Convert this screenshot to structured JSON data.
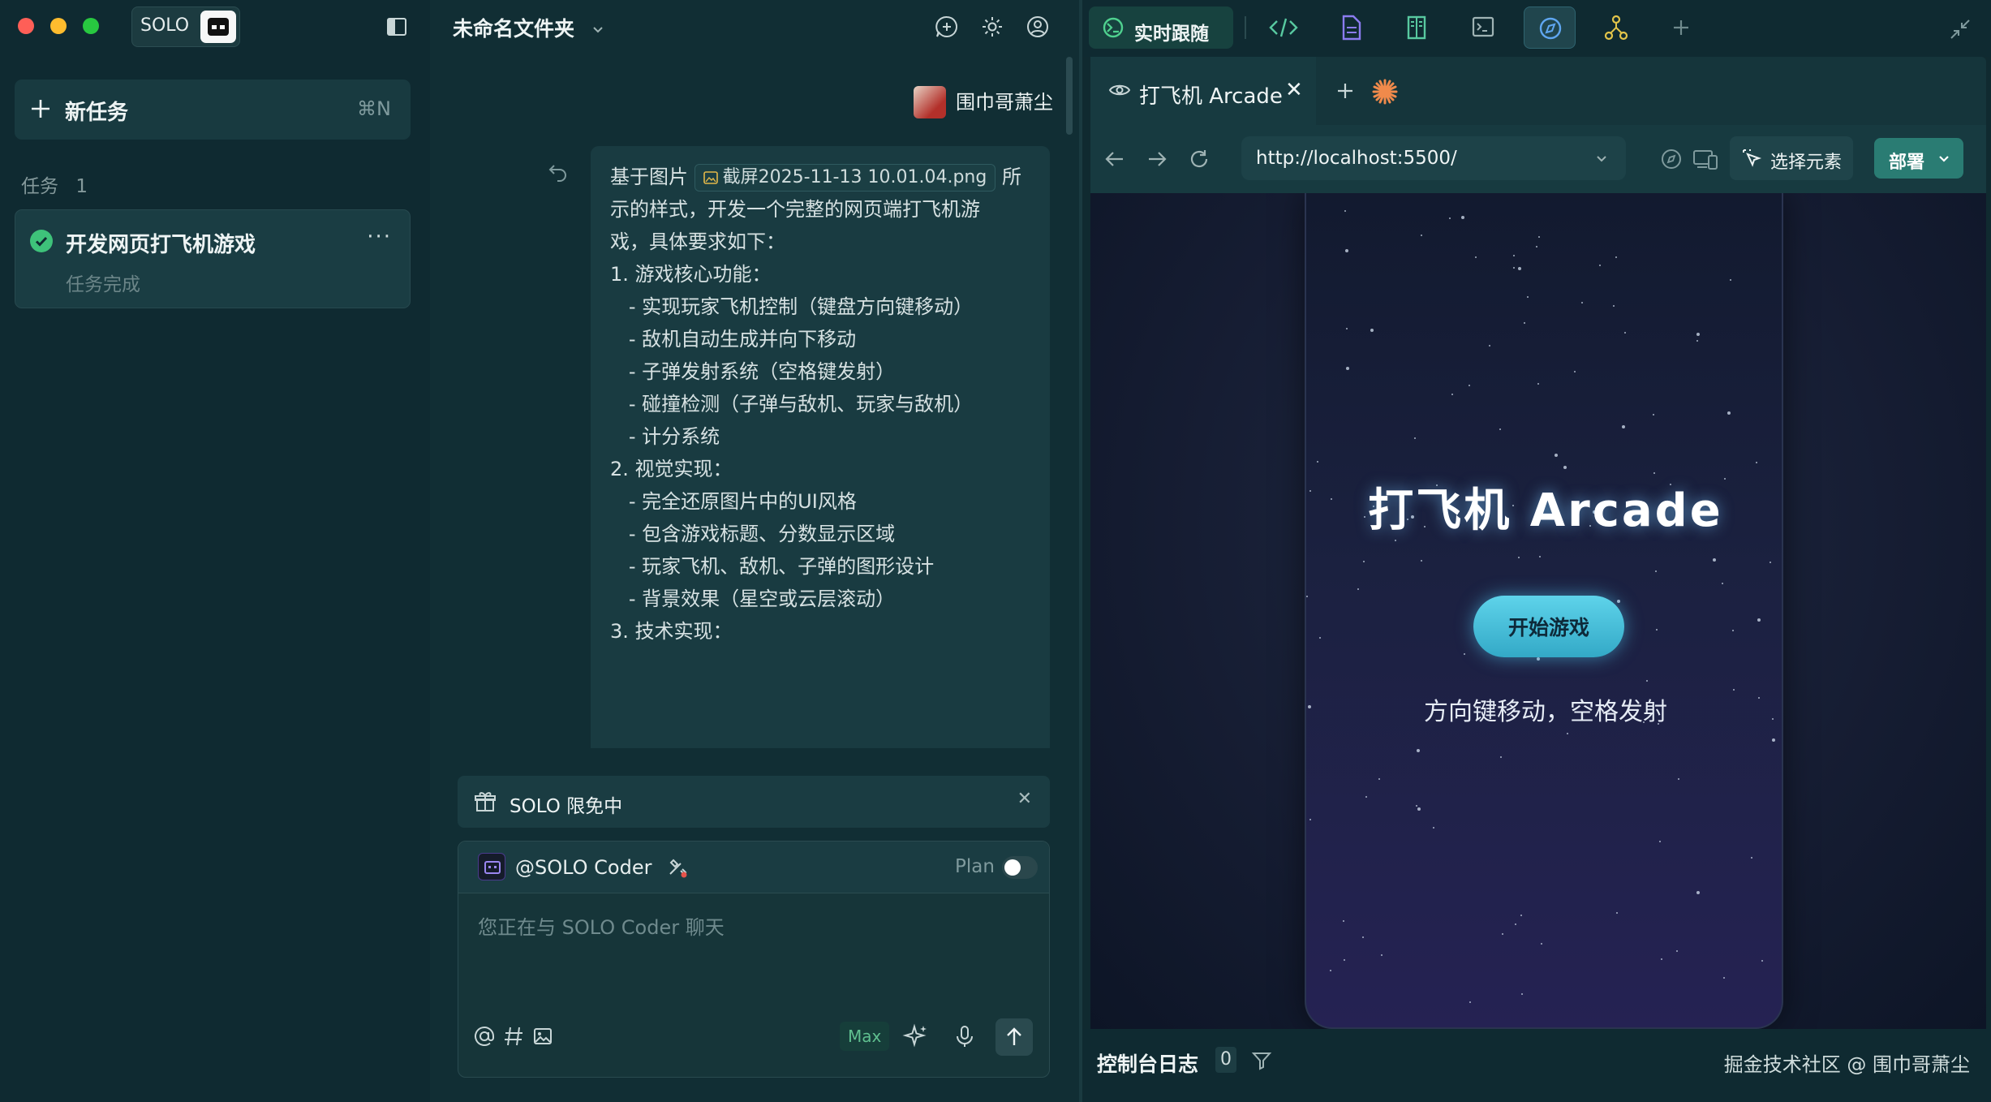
{
  "colors": {
    "sidebar_bg": "#0f2a31",
    "accent_green": "#3ec27a",
    "deploy_button": "#2a7c73",
    "start_button": "#4cc3e0",
    "traffic_red": "#fe5f57",
    "traffic_yellow": "#febc2e",
    "traffic_green": "#28c840"
  },
  "sidebar": {
    "brand": "SOLO",
    "brand_icon": "solo-coder-icon",
    "new_task_label": "新任务",
    "new_task_shortcut": "⌘N",
    "tasks_header": "任务",
    "tasks_count": "1",
    "tasks": [
      {
        "title": "开发网页打飞机游戏",
        "status": "任务完成",
        "more": "···"
      }
    ]
  },
  "chat": {
    "folder_title": "未命名文件夹",
    "header_icons": [
      "new-chat-icon",
      "settings-icon",
      "account-icon"
    ],
    "user_name": "围巾哥萧尘",
    "message": {
      "prefix": "基于图片",
      "attachment": "截屏2025-11-13 10.01.04.png",
      "suffix": "所",
      "lines": [
        "示的样式，开发一个完整的网页端打飞机游",
        "戏，具体要求如下：",
        "",
        "1. 游戏核心功能：",
        "   - 实现玩家飞机控制（键盘方向键移动）",
        "   - 敌机自动生成并向下移动",
        "   - 子弹发射系统（空格键发射）",
        "   - 碰撞检测（子弹与敌机、玩家与敌机）",
        "   - 计分系统",
        "",
        "2. 视觉实现：",
        "   - 完全还原图片中的UI风格",
        "   - 包含游戏标题、分数显示区域",
        "   - 玩家飞机、敌机、子弹的图形设计",
        "   - 背景效果（星空或云层滚动）",
        "",
        "3. 技术实现："
      ]
    },
    "promo": {
      "label": "SOLO 限免中",
      "close": "✕"
    },
    "composer": {
      "agent": "@SOLO Coder",
      "plan_label": "Plan",
      "plan_enabled": false,
      "placeholder": "您正在与 SOLO Coder 聊天",
      "max_label": "Max"
    }
  },
  "preview": {
    "follow_label": "实时跟随",
    "toolbar_icons": [
      "code-icon",
      "document-icon",
      "book-icon",
      "terminal-icon",
      "browser-compass-icon",
      "git-graph-icon",
      "add-icon",
      "collapse-icon"
    ],
    "tab_title": "打飞机 Arcade",
    "tab_close": "✕",
    "url": "http://localhost:5500/",
    "select_element_label": "选择元素",
    "deploy_label": "部署",
    "game": {
      "title": "打飞机 Arcade",
      "start_button": "开始游戏",
      "hint": "方向键移动，空格发射"
    },
    "console": {
      "label": "控制台日志",
      "count": "0"
    },
    "watermark": "掘金技术社区 @ 围巾哥萧尘"
  }
}
